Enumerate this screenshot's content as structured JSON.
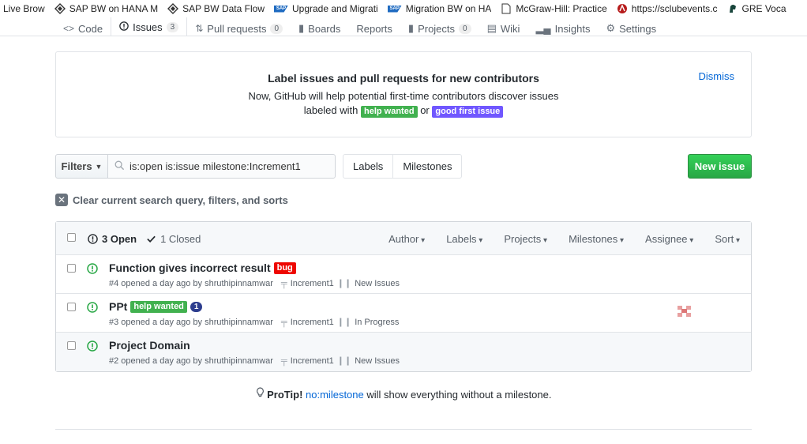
{
  "bookmarks": [
    {
      "label": "Live Brow",
      "icon": "none"
    },
    {
      "label": "SAP BW on HANA M",
      "icon": "diamond-icon"
    },
    {
      "label": "SAP BW Data Flow",
      "icon": "diamond-icon"
    },
    {
      "label": "Upgrade and Migrati",
      "icon": "sap-icon"
    },
    {
      "label": "Migration BW on HA",
      "icon": "sap-icon"
    },
    {
      "label": "McGraw-Hill: Practice",
      "icon": "page-icon"
    },
    {
      "label": "https://sclubevents.c",
      "icon": "sclub-icon"
    },
    {
      "label": "GRE Voca",
      "icon": "spartan-icon"
    }
  ],
  "reponav": [
    {
      "label": "Code",
      "icon": "code-icon",
      "count": null,
      "selected": false
    },
    {
      "label": "Issues",
      "icon": "issue-icon",
      "count": "3",
      "selected": true
    },
    {
      "label": "Pull requests",
      "icon": "pr-icon",
      "count": "0",
      "selected": false
    },
    {
      "label": "Boards",
      "icon": "board-icon",
      "count": null,
      "selected": false
    },
    {
      "label": "Reports",
      "icon": "none",
      "count": null,
      "selected": false
    },
    {
      "label": "Projects",
      "icon": "project-icon",
      "count": "0",
      "selected": false
    },
    {
      "label": "Wiki",
      "icon": "wiki-icon",
      "count": null,
      "selected": false
    },
    {
      "label": "Insights",
      "icon": "graph-icon",
      "count": null,
      "selected": false
    },
    {
      "label": "Settings",
      "icon": "gear-icon",
      "count": null,
      "selected": false
    }
  ],
  "banner": {
    "title": "Label issues and pull requests for new contributors",
    "line1": "Now, GitHub will help potential first-time contributors discover issues",
    "line2_prefix": "labeled with",
    "label_a": "help wanted",
    "line2_or": "or",
    "label_b": "good first issue",
    "dismiss": "Dismiss"
  },
  "filterbar": {
    "filters_label": "Filters",
    "search_value": "is:open is:issue milestone:Increment1",
    "labels_label": "Labels",
    "milestones_label": "Milestones",
    "new_issue_label": "New issue"
  },
  "clear_query": "Clear current search query, filters, and sorts",
  "table": {
    "open_label": "3 Open",
    "closed_label": "1 Closed",
    "filters": [
      "Author",
      "Labels",
      "Projects",
      "Milestones",
      "Assignee",
      "Sort"
    ]
  },
  "issues": [
    {
      "title": "Function gives incorrect result",
      "label": "bug",
      "label_color": "#ee0701",
      "comments": null,
      "meta": "#4 opened a day ago by shruthipinnamwar",
      "milestone": "Increment1",
      "project": "New Issues",
      "assignee": false
    },
    {
      "title": "PPt",
      "label": "help wanted",
      "label_color": "#41b14f",
      "comments": "1",
      "meta": "#3 opened a day ago by shruthipinnamwar",
      "milestone": "Increment1",
      "project": "In Progress",
      "assignee": true
    },
    {
      "title": "Project Domain",
      "label": null,
      "label_color": null,
      "comments": null,
      "meta": "#2 opened a day ago by shruthipinnamwar",
      "milestone": "Increment1",
      "project": "New Issues",
      "assignee": false
    }
  ],
  "protip": {
    "prefix": "ProTip!",
    "link": "no:milestone",
    "suffix": "will show everything without a milestone."
  },
  "colors": {
    "accent": "#0366d6",
    "success": "#28a745",
    "open_icon": "#28a745"
  }
}
